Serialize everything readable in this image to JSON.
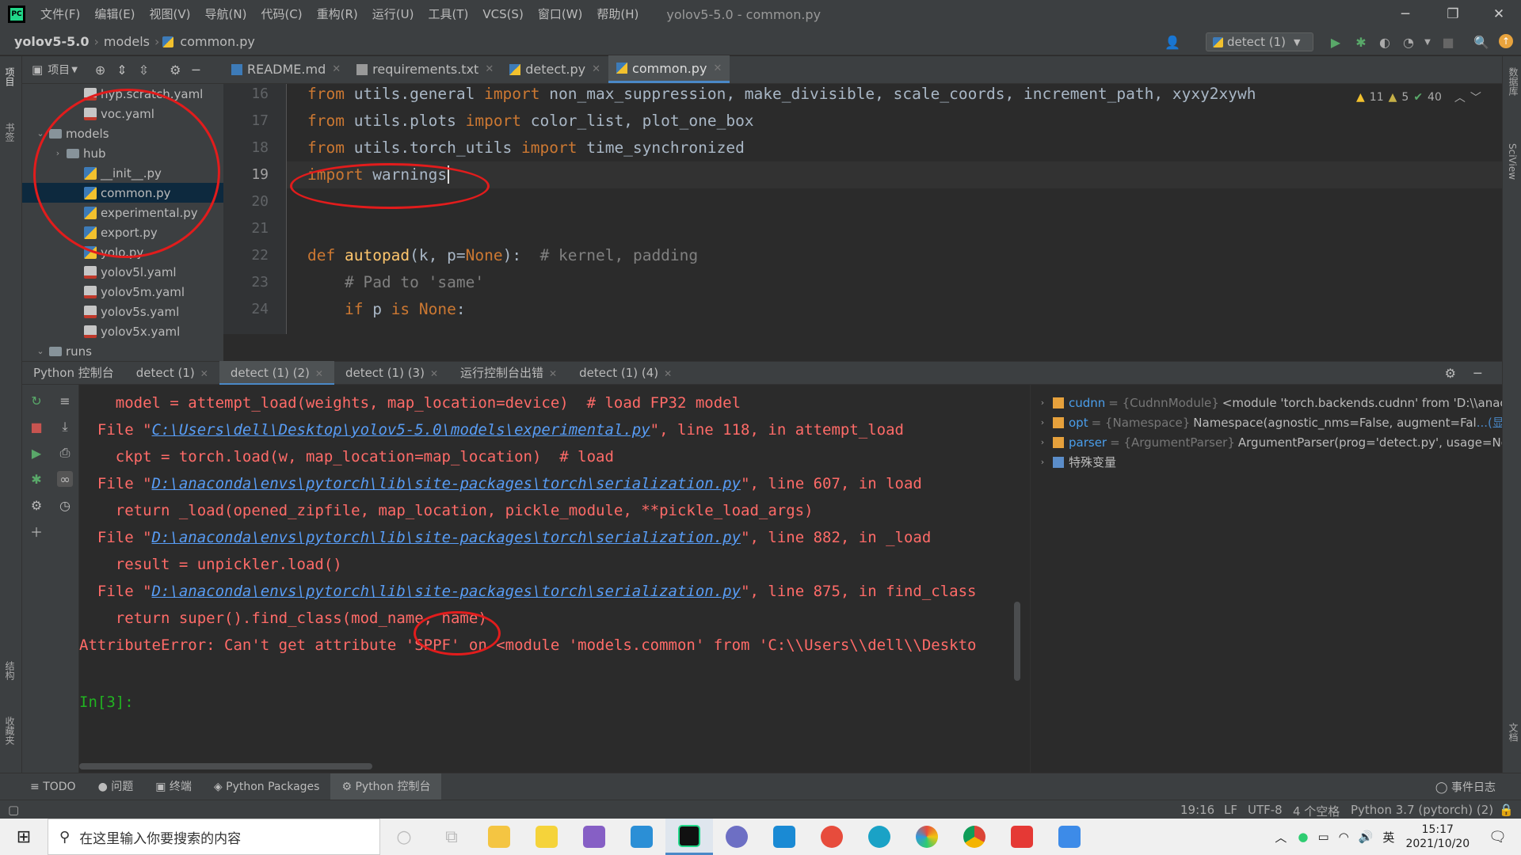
{
  "window": {
    "menu": [
      "文件(F)",
      "编辑(E)",
      "视图(V)",
      "导航(N)",
      "代码(C)",
      "重构(R)",
      "运行(U)",
      "工具(T)",
      "VCS(S)",
      "窗口(W)",
      "帮助(H)"
    ],
    "title": "yolov5-5.0 - common.py"
  },
  "breadcrumb": [
    "yolov5-5.0",
    "models",
    "common.py"
  ],
  "run_config": "detect (1)",
  "left_strip": {
    "top": "项目",
    "mid": "书签",
    "bottom1": "结构",
    "bottom2": "收藏夹"
  },
  "right_strip": {
    "top": "数据库",
    "mid": "SciView",
    "bottom": "文档"
  },
  "project_panel": {
    "label": "项目"
  },
  "project_tree": [
    {
      "label": "hyp.scratch.yaml",
      "type": "yml",
      "depth": 3
    },
    {
      "label": "voc.yaml",
      "type": "yml",
      "depth": 3
    },
    {
      "label": "models",
      "type": "folder",
      "depth": 1,
      "expanded": true
    },
    {
      "label": "hub",
      "type": "folder",
      "depth": 2,
      "expanded": false
    },
    {
      "label": "__init__.py",
      "type": "py",
      "depth": 3
    },
    {
      "label": "common.py",
      "type": "py",
      "depth": 3,
      "selected": true
    },
    {
      "label": "experimental.py",
      "type": "py",
      "depth": 3
    },
    {
      "label": "export.py",
      "type": "py",
      "depth": 3
    },
    {
      "label": "yolo.py",
      "type": "py",
      "depth": 3
    },
    {
      "label": "yolov5l.yaml",
      "type": "yml",
      "depth": 3
    },
    {
      "label": "yolov5m.yaml",
      "type": "yml",
      "depth": 3
    },
    {
      "label": "yolov5s.yaml",
      "type": "yml",
      "depth": 3
    },
    {
      "label": "yolov5x.yaml",
      "type": "yml",
      "depth": 3
    },
    {
      "label": "runs",
      "type": "folder",
      "depth": 1,
      "expanded": true
    }
  ],
  "editor_tabs": [
    {
      "label": "README.md",
      "active": false
    },
    {
      "label": "requirements.txt",
      "active": false
    },
    {
      "label": "detect.py",
      "active": false
    },
    {
      "label": "common.py",
      "active": true
    }
  ],
  "inspections": {
    "warnings": "11",
    "weak_warnings": "5",
    "ok": "40"
  },
  "code_lines": [
    {
      "no": "16",
      "html": "<span class=\"kw\">from</span> utils.general <span class=\"kw\">import</span> non_max_suppression, make_divisible, scale_coords, increment_path, xyxy2xywh"
    },
    {
      "no": "17",
      "html": "<span class=\"kw\">from</span> utils.plots <span class=\"kw\">import</span> color_list, plot_one_box"
    },
    {
      "no": "18",
      "html": "<span class=\"kw\">from</span> utils.torch_utils <span class=\"kw\">import</span> time_synchronized"
    },
    {
      "no": "19",
      "html": "<span class=\"kw\">import</span> warnings",
      "caret": true
    },
    {
      "no": "20",
      "html": ""
    },
    {
      "no": "21",
      "html": ""
    },
    {
      "no": "22",
      "html": "<span class=\"kw\">def</span> <span class=\"fn\">autopad</span>(k, p=<span class=\"kw\">None</span>):  <span class=\"cm\"># kernel, padding</span>"
    },
    {
      "no": "23",
      "html": "    <span class=\"cm\"># Pad to 'same'</span>"
    },
    {
      "no": "24",
      "html": "    <span class=\"kw\">if</span> p <span class=\"kw\">is</span> <span class=\"kw\">None</span>:"
    }
  ],
  "console_tabs": [
    {
      "label": "Python 控制台",
      "active": false,
      "closable": false
    },
    {
      "label": "detect (1)",
      "active": false,
      "closable": true
    },
    {
      "label": "detect (1) (2)",
      "active": true,
      "closable": true
    },
    {
      "label": "detect (1) (3)",
      "active": false,
      "closable": true
    },
    {
      "label": "运行控制台出错",
      "active": false,
      "closable": true
    },
    {
      "label": "detect (1) (4)",
      "active": false,
      "closable": true
    }
  ],
  "console_lines": [
    {
      "indent": "    ",
      "text": "model = attempt_load(weights, map_location=device)  # load FP32 model"
    },
    {
      "indent": "  ",
      "pre": "File \"",
      "link": "C:\\Users\\dell\\Desktop\\yolov5-5.0\\models\\experimental.py",
      "post": "\", line 118, in attempt_load"
    },
    {
      "indent": "    ",
      "text": "ckpt = torch.load(w, map_location=map_location)  # load"
    },
    {
      "indent": "  ",
      "pre": "File \"",
      "link": "D:\\anaconda\\envs\\pytorch\\lib\\site-packages\\torch\\serialization.py",
      "post": "\", line 607, in load"
    },
    {
      "indent": "    ",
      "text": "return _load(opened_zipfile, map_location, pickle_module, **pickle_load_args)"
    },
    {
      "indent": "  ",
      "pre": "File \"",
      "link": "D:\\anaconda\\envs\\pytorch\\lib\\site-packages\\torch\\serialization.py",
      "post": "\", line 882, in _load"
    },
    {
      "indent": "    ",
      "text": "result = unpickler.load()"
    },
    {
      "indent": "  ",
      "pre": "File \"",
      "link": "D:\\anaconda\\envs\\pytorch\\lib\\site-packages\\torch\\serialization.py",
      "post": "\", line 875, in find_class"
    },
    {
      "indent": "    ",
      "text": "return super().find_class(mod_name, name)"
    },
    {
      "indent": "",
      "text": "AttributeError: Can't get attribute 'SPPF' on <module 'models.common' from 'C:\\\\Users\\\\dell\\\\Deskto"
    }
  ],
  "console_prompt": "In[3]:",
  "variables": [
    {
      "name": "cudnn",
      "type": "= {CudnnModule}",
      "value": "<module 'torch.backends.cudnn' from 'D:\\\\anaco"
    },
    {
      "name": "opt",
      "type": "= {Namespace}",
      "value": "Namespace(agnostic_nms=False, augment=Fal",
      "more": "...(显示)"
    },
    {
      "name": "parser",
      "type": "= {ArgumentParser}",
      "value": "ArgumentParser(prog='detect.py', usage=Non"
    },
    {
      "name": "特殊变量",
      "type": "",
      "value": "",
      "special": true
    }
  ],
  "bottom_tabs": [
    {
      "label": "TODO",
      "active": false
    },
    {
      "label": "问题",
      "active": false
    },
    {
      "label": "终端",
      "active": false
    },
    {
      "label": "Python Packages",
      "active": false
    },
    {
      "label": "Python 控制台",
      "active": true
    }
  ],
  "event_log": "事件日志",
  "status": {
    "position": "19:16",
    "line_sep": "LF",
    "encoding": "UTF-8",
    "indent": "4 个空格",
    "interpreter": "Python 3.7 (pytorch) (2)"
  },
  "taskbar": {
    "search_placeholder": "在这里输入你要搜索的内容",
    "ime": "英",
    "time": "15:17",
    "date": "2021/10/20"
  },
  "colors": {
    "accent": "#4a88c7",
    "error": "#ff6b68",
    "link": "#589df6",
    "annotation": "#e21c1c"
  }
}
